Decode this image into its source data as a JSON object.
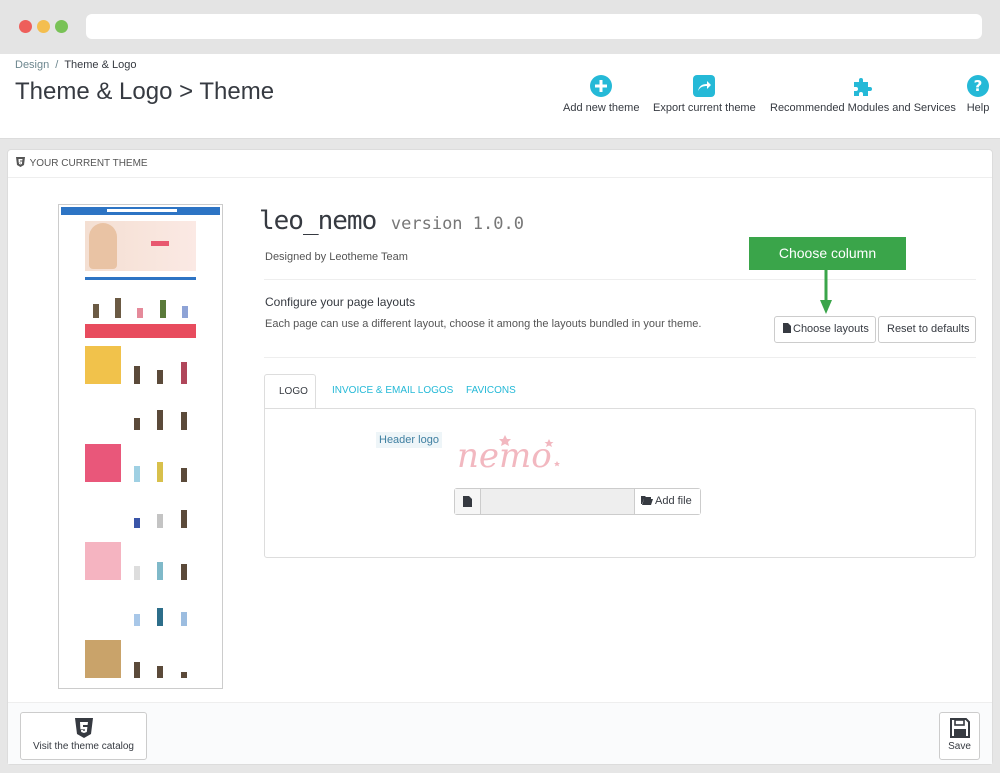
{
  "breadcrumb": {
    "parent": "Design",
    "current": "Theme & Logo"
  },
  "page_title": "Theme & Logo > Theme",
  "toolbar": {
    "add_new_theme": "Add new theme",
    "export_current_theme": "Export current theme",
    "recommended": "Recommended Modules and Services",
    "help": "Help"
  },
  "panel": {
    "heading": "YOUR CURRENT THEME"
  },
  "theme": {
    "name": "leo_nemo",
    "version": "version 1.0.0",
    "designed_by": "Designed by Leotheme Team"
  },
  "layouts": {
    "title": "Configure your page layouts",
    "description": "Each page can use a different layout, choose it among the layouts bundled in your theme.",
    "choose_label": "Choose layouts",
    "reset_label": "Reset to defaults"
  },
  "annotation": {
    "label": "Choose column"
  },
  "tabs": [
    {
      "label": "LOGO"
    },
    {
      "label": "INVOICE & EMAIL LOGOS"
    },
    {
      "label": "FAVICONS"
    }
  ],
  "logo_tab": {
    "header_logo_label": "Header logo",
    "logo_text": "nemo",
    "add_file_label": "Add file"
  },
  "footer": {
    "catalog_label": "Visit the theme catalog",
    "save_label": "Save"
  },
  "colors": {
    "accent": "#25b9d7",
    "annotation_green": "#3aa54a",
    "logo_pink": "#f2b8c0"
  }
}
